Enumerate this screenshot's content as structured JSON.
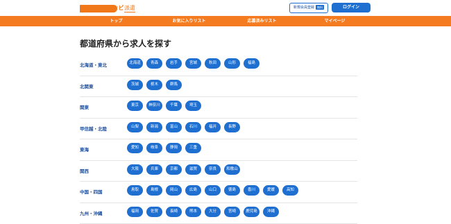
{
  "header": {
    "logo_mark": "リクナビ",
    "logo_sub": "派遣",
    "register_label": "新規会員登録",
    "register_badge": "無料",
    "login_label": "ログイン"
  },
  "nav": {
    "items": [
      {
        "label": "トップ"
      },
      {
        "label": "お気に入りリスト"
      },
      {
        "label": "応募済みリスト"
      },
      {
        "label": "マイページ"
      }
    ]
  },
  "main": {
    "title": "都道府県から求人を探す",
    "regions": [
      {
        "label": "北海道・東北",
        "prefs": [
          "北海道",
          "青森",
          "岩手",
          "宮城",
          "秋田",
          "山形",
          "福島"
        ]
      },
      {
        "label": "北関東",
        "prefs": [
          "茨城",
          "栃木",
          "群馬"
        ]
      },
      {
        "label": "関東",
        "prefs": [
          "東京",
          "神奈川",
          "千葉",
          "埼玉"
        ]
      },
      {
        "label": "甲信越・北陸",
        "prefs": [
          "山梨",
          "新潟",
          "富山",
          "石川",
          "福井",
          "長野"
        ]
      },
      {
        "label": "東海",
        "prefs": [
          "愛知",
          "岐阜",
          "静岡",
          "三重"
        ]
      },
      {
        "label": "関西",
        "prefs": [
          "大阪",
          "兵庫",
          "京都",
          "滋賀",
          "奈良",
          "和歌山"
        ]
      },
      {
        "label": "中国・四国",
        "prefs": [
          "鳥取",
          "島根",
          "岡山",
          "広島",
          "山口",
          "徳島",
          "香川",
          "愛媛",
          "高知"
        ]
      },
      {
        "label": "九州・沖縄",
        "prefs": [
          "福岡",
          "佐賀",
          "長崎",
          "熊本",
          "大分",
          "宮崎",
          "鹿児島",
          "沖縄"
        ]
      }
    ]
  }
}
